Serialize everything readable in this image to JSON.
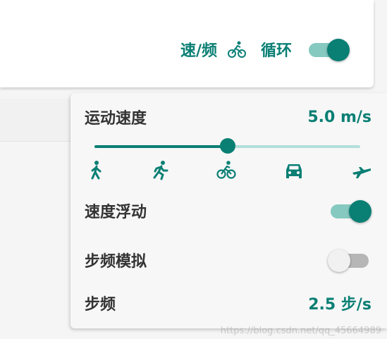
{
  "top": {
    "speed_cadence_label": "速/频",
    "speed_cadence_icon": "bike-icon",
    "loop_label": "循环",
    "loop_on": true
  },
  "panel": {
    "speed_label": "运动速度",
    "speed_value": "5.0 m/s",
    "slider_level": 0.5,
    "modes": [
      "walk-icon",
      "run-icon",
      "bike-icon",
      "car-icon",
      "plane-icon"
    ],
    "float_label": "速度浮动",
    "float_on": true,
    "cadence_sim_label": "步频模拟",
    "cadence_sim_on": false,
    "cadence_label": "步频",
    "cadence_value": "2.5 步/s"
  },
  "watermark": "https://blog.csdn.net/qq_45664989",
  "colors": {
    "accent": "#0a7f74",
    "accent_light": "#86c9c0",
    "track_light": "#b2dfdb",
    "panel_bg": "#f7f7f7"
  }
}
